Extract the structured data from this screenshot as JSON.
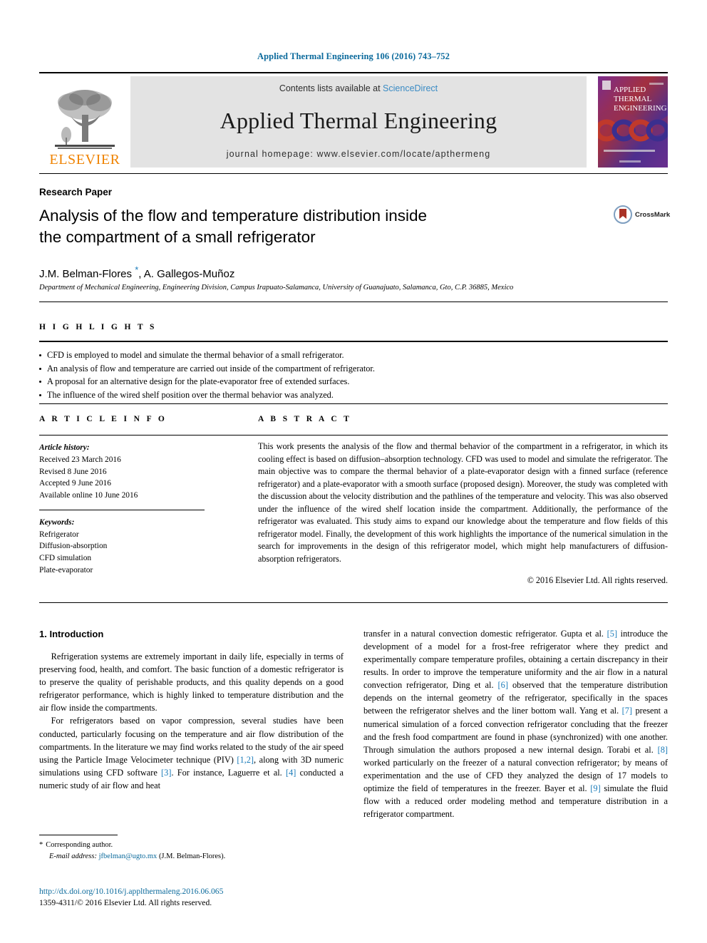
{
  "running_head": "Applied Thermal Engineering 106 (2016) 743–752",
  "masthead": {
    "publisher": "ELSEVIER",
    "contents_prefix": "Contents lists available at ",
    "sciencedirect": "ScienceDirect",
    "journal_title": "Applied Thermal Engineering",
    "homepage": "journal homepage: www.elsevier.com/locate/apthermeng",
    "cover_lines": [
      "APPLIED",
      "THERMAL",
      "ENGINEERING"
    ],
    "colors": {
      "elsevier_orange": "#ef8200",
      "sciencedirect_blue": "#3a8bc4",
      "banner_gray": "#e3e3e3",
      "running_head_blue": "#0b6a9c",
      "link_blue": "#1a7bb9"
    }
  },
  "article": {
    "type": "Research Paper",
    "title_line1": "Analysis of the flow and temperature distribution inside",
    "title_line2": "the compartment of a small refrigerator",
    "authors": "J.M. Belman-Flores ",
    "authors_tail": ", A. Gallegos-Muñoz",
    "corresponding_marker": "*",
    "affiliation": "Department of Mechanical Engineering, Engineering Division, Campus Irapuato-Salamanca, University of Guanajuato, Salamanca, Gto, C.P. 36885, Mexico",
    "crossmark_label": "CrossMark"
  },
  "highlights": {
    "label": "H I G H L I G H T S",
    "items": [
      "CFD is employed to model and simulate the thermal behavior of a small refrigerator.",
      "An analysis of flow and temperature are carried out inside of the compartment of refrigerator.",
      "A proposal for an alternative design for the plate-evaporator free of extended surfaces.",
      "The influence of the wired shelf position over the thermal behavior was analyzed."
    ]
  },
  "article_info": {
    "label": "A R T I C L E    I N F O",
    "history_title": "Article history:",
    "history": [
      "Received 23 March 2016",
      "Revised 8 June 2016",
      "Accepted 9 June 2016",
      "Available online 10 June 2016"
    ],
    "keywords_title": "Keywords:",
    "keywords": [
      "Refrigerator",
      "Diffusion-absorption",
      "CFD simulation",
      "Plate-evaporator"
    ]
  },
  "abstract": {
    "label": "A B S T R A C T",
    "text": "This work presents the analysis of the flow and thermal behavior of the compartment in a refrigerator, in which its cooling effect is based on diffusion–absorption technology. CFD was used to model and simulate the refrigerator. The main objective was to compare the thermal behavior of a plate-evaporator design with a finned surface (reference refrigerator) and a plate-evaporator with a smooth surface (proposed design). Moreover, the study was completed with the discussion about the velocity distribution and the pathlines of the temperature and velocity. This was also observed under the influence of the wired shelf location inside the compartment. Additionally, the performance of the refrigerator was evaluated. This study aims to expand our knowledge about the temperature and flow fields of this refrigerator model. Finally, the development of this work highlights the importance of the numerical simulation in the search for improvements in the design of this refrigerator model, which might help manufacturers of diffusion-absorption refrigerators.",
    "copyright": "© 2016 Elsevier Ltd. All rights reserved."
  },
  "body": {
    "section_number_title": "1. Introduction",
    "left_paragraph_1": "Refrigeration systems are extremely important in daily life, especially in terms of preserving food, health, and comfort. The basic function of a domestic refrigerator is to preserve the quality of perishable products, and this quality depends on a good refrigerator performance, which is highly linked to temperature distribution and the air flow inside the compartments.",
    "left_paragraph_2_a": "For refrigerators based on vapor compression, several studies have been conducted, particularly focusing on the temperature and air flow distribution of the compartments. In the literature we may find works related to the study of the air speed using the Particle Image Velocimeter technique (PIV) ",
    "left_ref_12": "[1,2]",
    "left_paragraph_2_b": ", along with 3D numeric simulations using CFD software ",
    "left_ref_3": "[3]",
    "left_paragraph_2_c": ". For instance, Laguerre et al. ",
    "left_ref_4": "[4]",
    "left_paragraph_2_d": " conducted a numeric study of air flow and heat",
    "right_a": "transfer in a natural convection domestic refrigerator. Gupta et al. ",
    "right_ref_5": "[5]",
    "right_b": " introduce the development of a model for a frost-free refrigerator where they predict and experimentally compare temperature profiles, obtaining a certain discrepancy in their results. In order to improve the temperature uniformity and the air flow in a natural convection refrigerator, Ding et al. ",
    "right_ref_6": "[6]",
    "right_c": " observed that the temperature distribution depends on the internal geometry of the refrigerator, specifically in the spaces between the refrigerator shelves and the liner bottom wall. Yang et al. ",
    "right_ref_7": "[7]",
    "right_d": " present a numerical simulation of a forced convection refrigerator concluding that the freezer and the fresh food compartment are found in phase (synchronized) with one another. Through simulation the authors proposed a new internal design. Torabi et al. ",
    "right_ref_8": "[8]",
    "right_e": " worked particularly on the freezer of a natural convection refrigerator; by means of experimentation and the use of CFD they analyzed the design of 17 models to optimize the field of temperatures in the freezer. Bayer et al. ",
    "right_ref_9": "[9]",
    "right_f": " simulate the fluid flow with a reduced order modeling method and temperature distribution in a refrigerator compartment."
  },
  "footnote": {
    "corresponding_marker": "*",
    "corresponding_text": "Corresponding author.",
    "email_label": "E-mail address:",
    "email": "jfbelman@ugto.mx",
    "email_owner": "(J.M. Belman-Flores)."
  },
  "footer": {
    "doi": "http://dx.doi.org/10.1016/j.applthermaleng.2016.06.065",
    "issn_line": "1359-4311/© 2016 Elsevier Ltd. All rights reserved."
  }
}
